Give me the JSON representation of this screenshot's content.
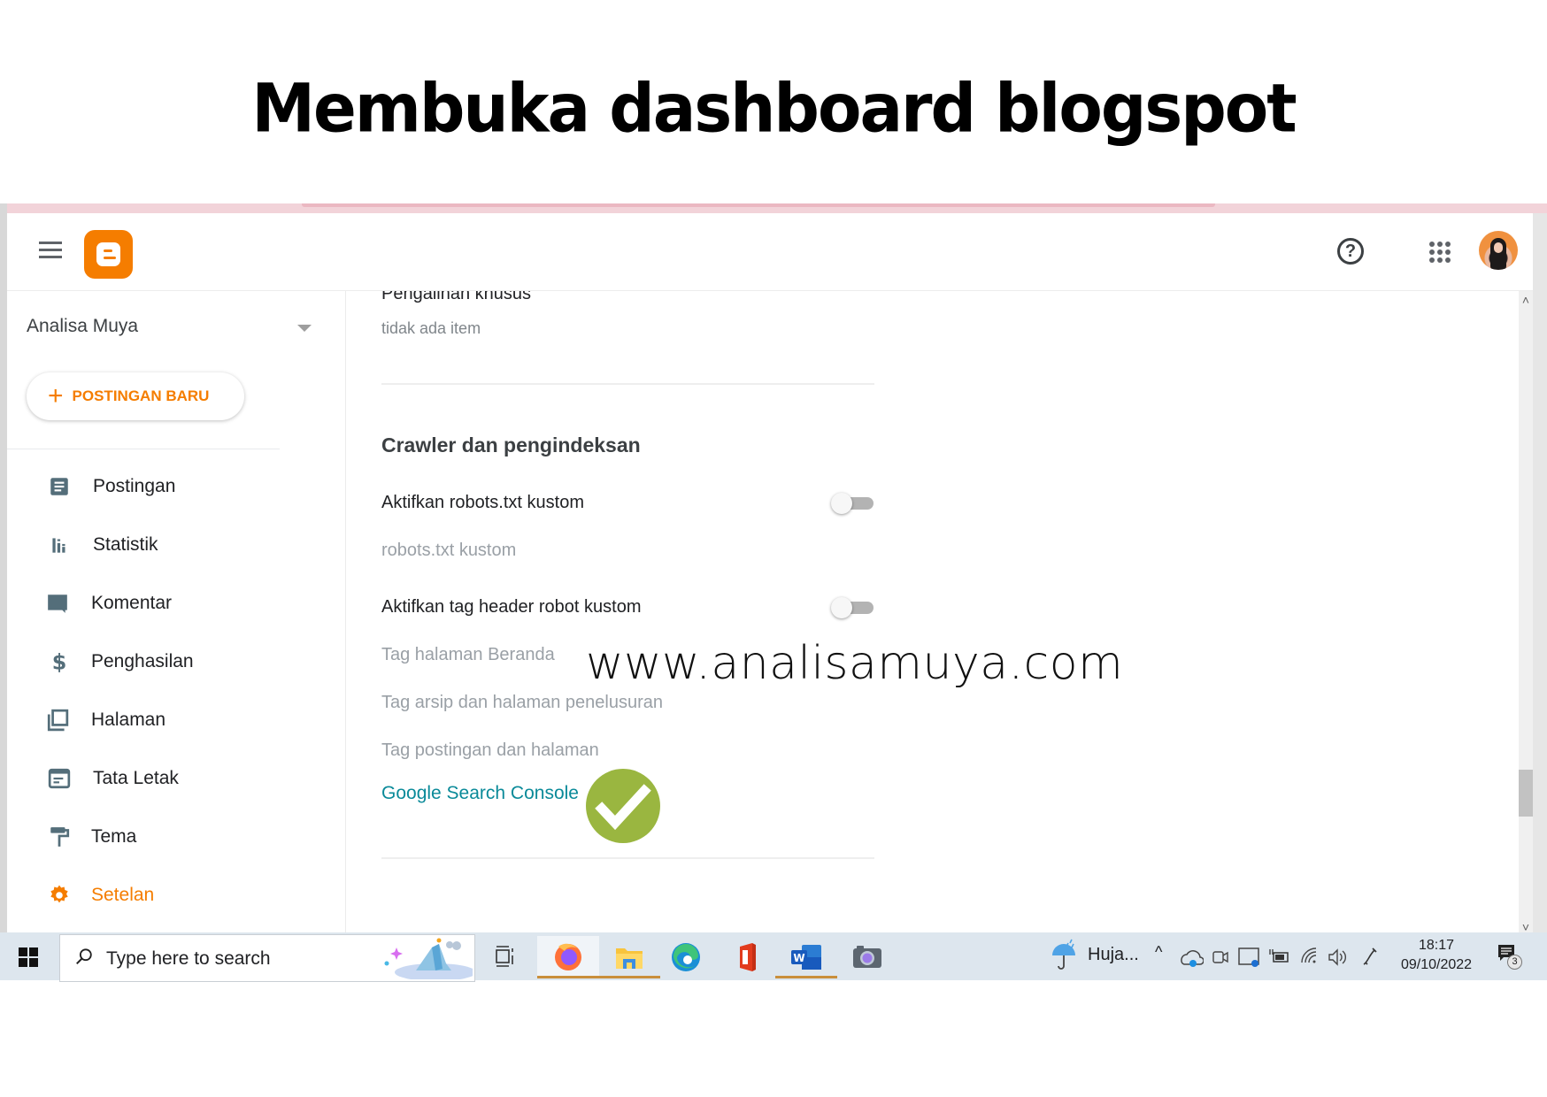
{
  "caption": "Membuka dashboard blogspot",
  "watermark": "www.analisamuya.com",
  "colors": {
    "brand_orange": "#f57d00",
    "link_teal": "#0a8a99",
    "check_green": "#9ab640",
    "taskbar_bg": "#dde6ee"
  },
  "header": {
    "menu_icon": "hamburger-icon",
    "logo": "blogger-logo",
    "help_icon": "help-circle-icon",
    "help_glyph": "?",
    "apps_icon": "apps-grid-icon",
    "avatar": "user-avatar"
  },
  "sidebar": {
    "blog_name": "Analisa Muya",
    "new_post_plus": "+",
    "new_post_label": "POSTINGAN BARU",
    "items": [
      {
        "label": "Postingan",
        "icon": "posts-icon",
        "active": false
      },
      {
        "label": "Statistik",
        "icon": "stats-icon",
        "active": false
      },
      {
        "label": "Komentar",
        "icon": "comment-icon",
        "active": false
      },
      {
        "label": "Penghasilan",
        "icon": "dollar-icon",
        "active": false
      },
      {
        "label": "Halaman",
        "icon": "pages-icon",
        "active": false
      },
      {
        "label": "Tata Letak",
        "icon": "layout-icon",
        "active": false
      },
      {
        "label": "Tema",
        "icon": "paint-roller-icon",
        "active": false
      },
      {
        "label": "Setelan",
        "icon": "gear-icon",
        "active": true
      }
    ]
  },
  "main": {
    "cut_heading": "Pengalihan khusus",
    "cut_value": "tidak ada item",
    "section_title": "Crawler dan pengindeksan",
    "robots_toggle_label": "Aktifkan robots.txt kustom",
    "robots_toggle_on": false,
    "robots_custom": "robots.txt kustom",
    "header_toggle_label": "Aktifkan tag header robot kustom",
    "header_toggle_on": false,
    "tag_home": "Tag halaman Beranda",
    "tag_archive": "Tag arsip dan halaman penelusuran",
    "tag_posts": "Tag postingan dan halaman",
    "gsc_link": "Google Search Console"
  },
  "scrollbar": {
    "up": "˄",
    "down": "˅"
  },
  "taskbar": {
    "start_icon": "windows-start-icon",
    "search_placeholder": "Type here to search",
    "apps": [
      {
        "name": "task-view-icon",
        "active": false,
        "open": false
      },
      {
        "name": "firefox-icon",
        "active": true,
        "open": true
      },
      {
        "name": "file-explorer-icon",
        "active": false,
        "open": true
      },
      {
        "name": "edge-icon",
        "active": false,
        "open": false
      },
      {
        "name": "office-icon",
        "active": false,
        "open": false
      },
      {
        "name": "word-icon",
        "active": false,
        "open": true
      },
      {
        "name": "camera-icon",
        "active": false,
        "open": false
      }
    ],
    "weather": "Huja...",
    "tray_chevron": "^",
    "time": "18:17",
    "date": "09/10/2022",
    "notification_count": "3"
  }
}
